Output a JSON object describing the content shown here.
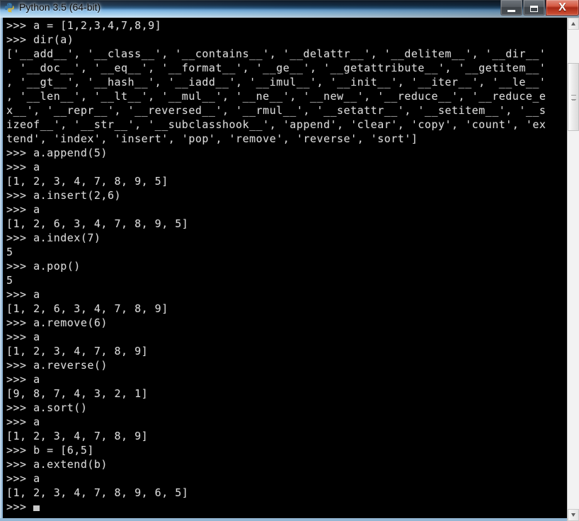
{
  "window": {
    "title": "Python 3.5 (64-bit)",
    "icon": "python-logo-icon",
    "controls": {
      "minimize_label": "Minimize",
      "maximize_label": "Maximize",
      "close_label": "X"
    }
  },
  "console": {
    "prompt": ">>>",
    "foreground_color": "#d8d8d8",
    "background_color": "#000000",
    "lines": [
      ">>> a = [1,2,3,4,7,8,9]",
      ">>> dir(a)",
      "['__add__', '__class__', '__contains__', '__delattr__', '__delitem__', '__dir__'",
      ", '__doc__', '__eq__', '__format__', '__ge__', '__getattribute__', '__getitem__'",
      ", '__gt__', '__hash__', '__iadd__', '__imul__', '__init__', '__iter__', '__le__'",
      ", '__len__', '__lt__', '__mul__', '__ne__', '__new__', '__reduce__', '__reduce_e",
      "x__', '__repr__', '__reversed__', '__rmul__', '__setattr__', '__setitem__', '__s",
      "izeof__', '__str__', '__subclasshook__', 'append', 'clear', 'copy', 'count', 'ex",
      "tend', 'index', 'insert', 'pop', 'remove', 'reverse', 'sort']",
      ">>> a.append(5)",
      ">>> a",
      "[1, 2, 3, 4, 7, 8, 9, 5]",
      ">>> a.insert(2,6)",
      ">>> a",
      "[1, 2, 6, 3, 4, 7, 8, 9, 5]",
      ">>> a.index(7)",
      "5",
      ">>> a.pop()",
      "5",
      ">>> a",
      "[1, 2, 6, 3, 4, 7, 8, 9]",
      ">>> a.remove(6)",
      ">>> a",
      "[1, 2, 3, 4, 7, 8, 9]",
      ">>> a.reverse()",
      ">>> a",
      "[9, 8, 7, 4, 3, 2, 1]",
      ">>> a.sort()",
      ">>> a",
      "[1, 2, 3, 4, 7, 8, 9]",
      ">>> b = [6,5]",
      ">>> a.extend(b)",
      ">>> a",
      "[1, 2, 3, 4, 7, 8, 9, 6, 5]"
    ],
    "last_prompt": ">>> "
  },
  "scrollbar": {
    "up_arrow": "scroll-up-arrow-icon",
    "down_arrow": "scroll-down-arrow-icon",
    "thumb": "scrollbar-thumb"
  }
}
